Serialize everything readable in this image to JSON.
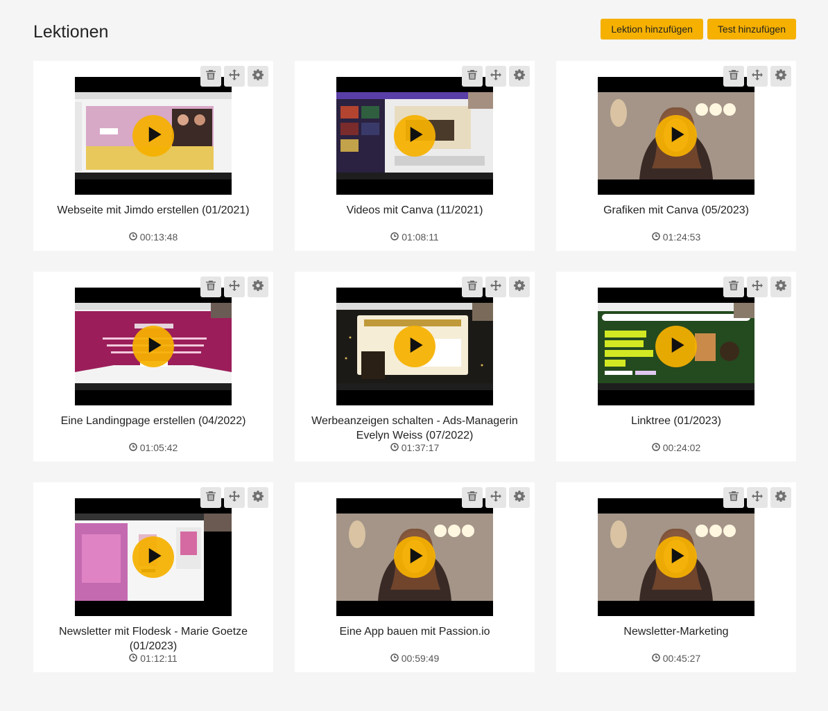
{
  "page": {
    "title": "Lektionen",
    "buttons": {
      "add_lesson": "Lektion hinzufügen",
      "add_test": "Test hinzufügen"
    }
  },
  "accent_color": "#f5b000",
  "icons": {
    "delete": "trash-icon",
    "move": "move-arrows-icon",
    "settings": "gear-icon",
    "play": "play-icon",
    "clock": "clock-icon"
  },
  "lessons": [
    {
      "title": "Webseite mit Jimdo erstellen (01/2021)",
      "duration": "00:13:48",
      "thumbnail": "screen-share-jimdo"
    },
    {
      "title": "Videos mit Canva (11/2021)",
      "duration": "01:08:11",
      "thumbnail": "screen-share-canva"
    },
    {
      "title": "Grafiken mit Canva (05/2023)",
      "duration": "01:24:53",
      "thumbnail": "webcam-speaker"
    },
    {
      "title": "Eine Landingpage erstellen (04/2022)",
      "duration": "01:05:42",
      "thumbnail": "screen-share-landingpage"
    },
    {
      "title": "Werbeanzeigen schalten - Ads-Managerin Evelyn Weiss (07/2022)",
      "duration": "01:37:17",
      "thumbnail": "screen-share-workshop"
    },
    {
      "title": "Linktree (01/2023)",
      "duration": "00:24:02",
      "thumbnail": "screen-share-linktree"
    },
    {
      "title": "Newsletter mit Flodesk - Marie Goetze (01/2023)",
      "duration": "01:12:11",
      "thumbnail": "screen-share-flodesk"
    },
    {
      "title": "Eine App bauen mit Passion.io",
      "duration": "00:59:49",
      "thumbnail": "webcam-speaker"
    },
    {
      "title": "Newsletter-Marketing",
      "duration": "00:45:27",
      "thumbnail": "webcam-speaker"
    }
  ]
}
